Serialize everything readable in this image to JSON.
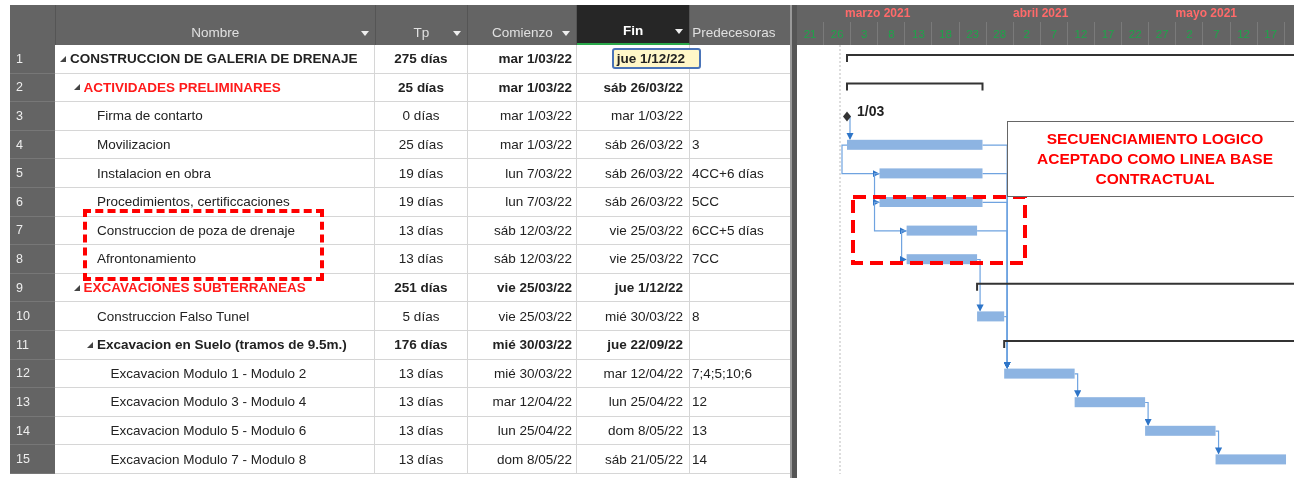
{
  "table": {
    "columns": [
      {
        "label": "Nombre",
        "filter": true,
        "selected": false
      },
      {
        "label": "Tp",
        "filter": true,
        "selected": false
      },
      {
        "label": "Comienzo",
        "filter": true,
        "selected": false
      },
      {
        "label": "Fin",
        "filter": true,
        "selected": true
      },
      {
        "label": "Predecesoras",
        "filter": false,
        "selected": false
      }
    ],
    "rows": [
      {
        "id": "1",
        "name": "CONSTRUCCION DE GALERIA DE DRENAJE",
        "duration": "275 días",
        "start": "mar 1/03/22",
        "finish": "jue 1/12/22",
        "kind": "summary",
        "expanded": true,
        "fin_active": true,
        "children": [
          {
            "id": "2",
            "name": "ACTIVIDADES PRELIMINARES",
            "duration": "25 días",
            "start": "mar 1/03/22",
            "finish": "sáb 26/03/22",
            "kind": "summary",
            "expanded": true,
            "fin_active": false,
            "children": [
              {
                "id": "3",
                "name": "Firma de contarto",
                "duration": "0 días",
                "start": "mar 1/03/22",
                "finish": "mar 1/03/22",
                "kind": "milestone",
                "milestone_label": "1/03",
                "fin_active": false
              },
              {
                "id": "4",
                "name": "Movilizacion",
                "duration": "25 días",
                "start": "mar 1/03/22",
                "finish": "sáb 26/03/22",
                "predecessors": "3",
                "kind": "task",
                "fin_active": false
              },
              {
                "id": "5",
                "name": "Instalacion en obra",
                "duration": "19 días",
                "start": "lun 7/03/22",
                "finish": "sáb 26/03/22",
                "predecessors": "4CC+6 días",
                "kind": "task",
                "fin_active": false
              },
              {
                "id": "6",
                "name": "Procedimientos, certificcaciones",
                "duration": "19 días",
                "start": "lun 7/03/22",
                "finish": "sáb 26/03/22",
                "predecessors": "5CC",
                "kind": "task",
                "fin_active": false
              },
              {
                "id": "7",
                "name": "Construccion de poza de drenaje",
                "duration": "13 días",
                "start": "sáb 12/03/22",
                "finish": "vie 25/03/22",
                "predecessors": "6CC+5 días",
                "kind": "task",
                "fin_active": false
              },
              {
                "id": "8",
                "name": "Afrontonamiento",
                "duration": "13 días",
                "start": "sáb 12/03/22",
                "finish": "vie 25/03/22",
                "predecessors": "7CC",
                "kind": "task",
                "fin_active": false
              }
            ]
          },
          {
            "id": "9",
            "name": "EXCAVACIONES SUBTERRANEAS",
            "duration": "251 días",
            "start": "vie 25/03/22",
            "finish": "jue 1/12/22",
            "kind": "summary",
            "expanded": true,
            "fin_active": false,
            "children": [
              {
                "id": "10",
                "name": "Construccion Falso Tunel",
                "duration": "5 días",
                "start": "vie 25/03/22",
                "finish": "mié 30/03/22",
                "predecessors": "8",
                "kind": "task",
                "fin_active": false
              },
              {
                "id": "11",
                "name": "Excavacion en Suelo (tramos de 9.5m.)",
                "duration": "176 días",
                "start": "mié 30/03/22",
                "finish": "jue 22/09/22",
                "kind": "summary",
                "expanded": true,
                "fin_active": false,
                "children": [
                  {
                    "id": "12",
                    "name": "Excavacion Modulo 1 - Modulo 2",
                    "duration": "13 días",
                    "start": "mié 30/03/22",
                    "finish": "mar 12/04/22",
                    "predecessors": "7;4;5;10;6",
                    "kind": "task",
                    "fin_active": false
                  },
                  {
                    "id": "13",
                    "name": "Excavacion Modulo 3 - Modulo 4",
                    "duration": "13 días",
                    "start": "mar 12/04/22",
                    "finish": "lun 25/04/22",
                    "predecessors": "12",
                    "kind": "task",
                    "fin_active": false
                  },
                  {
                    "id": "14",
                    "name": "Excavacion Modulo 5 - Modulo 6",
                    "duration": "13 días",
                    "start": "lun 25/04/22",
                    "finish": "dom 8/05/22",
                    "predecessors": "13",
                    "kind": "task",
                    "fin_active": false
                  },
                  {
                    "id": "15",
                    "name": "Excavacion Modulo 7 - Modulo 8",
                    "duration": "13 días",
                    "start": "dom 8/05/22",
                    "finish": "sáb 21/05/22",
                    "predecessors": "14",
                    "kind": "task",
                    "fin_active": false
                  }
                ]
              }
            ]
          }
        ]
      }
    ]
  },
  "timeline": {
    "months": [
      "marzo 2021",
      "abril 2021",
      "mayo 2021"
    ],
    "ticks": [
      "21",
      "26",
      "3",
      "8",
      "13",
      "18",
      "23",
      "28",
      "2",
      "7",
      "12",
      "17",
      "22",
      "27",
      "2",
      "7",
      "12",
      "17"
    ]
  },
  "annotation": "SECUENCIAMIENTO LOGICO ACEPTADO COMO LINEA BASE CONTRACTUAL"
}
